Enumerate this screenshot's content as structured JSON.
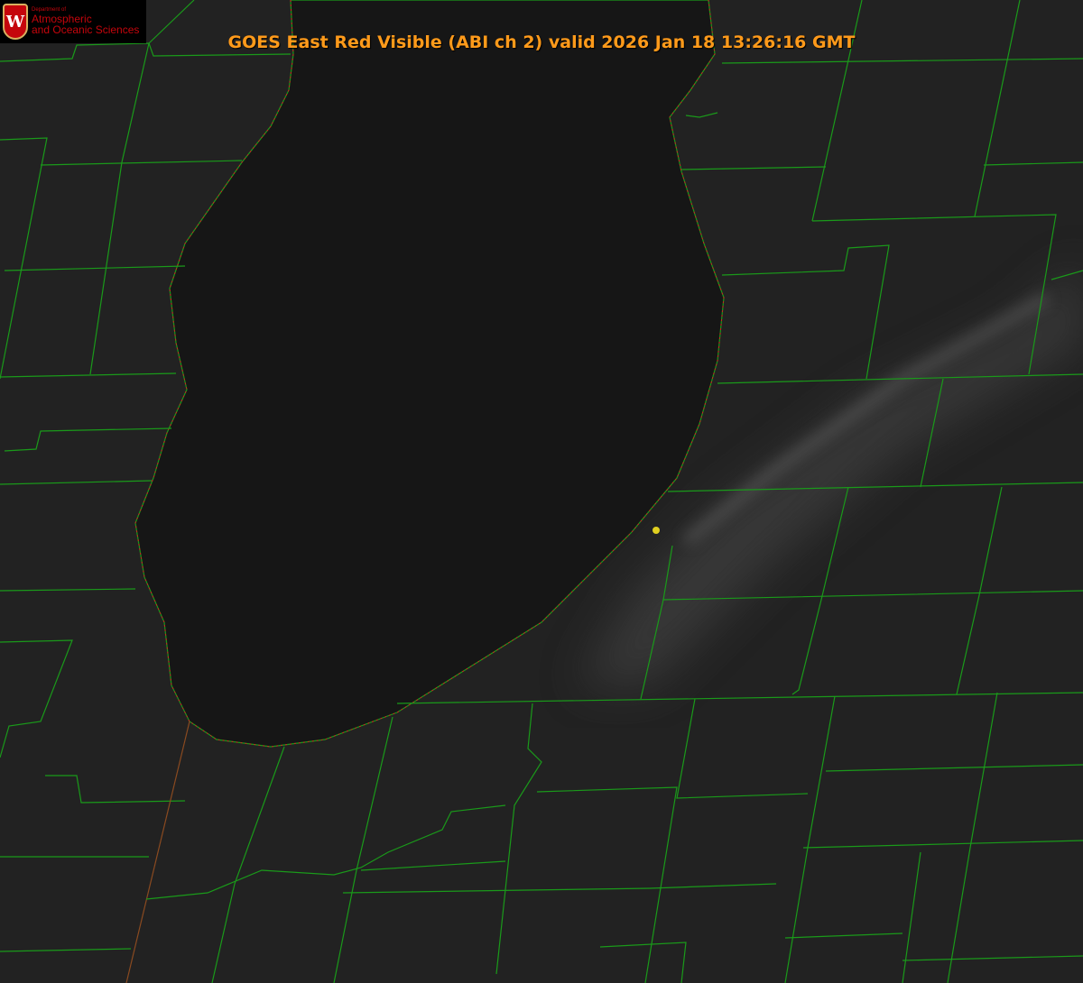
{
  "title": "GOES East Red Visible (ABI ch 2) valid 2026 Jan 18 13:26:16 GMT",
  "logo": {
    "dept": "Department of",
    "line1": "Atmospheric",
    "line2": "and Oceanic Sciences",
    "mark": "W"
  },
  "colors": {
    "county_lines": "#1a9a1a",
    "shoreline_dotted": "#d02020",
    "marker": "#e0d020",
    "title": "#ff9a1a"
  }
}
